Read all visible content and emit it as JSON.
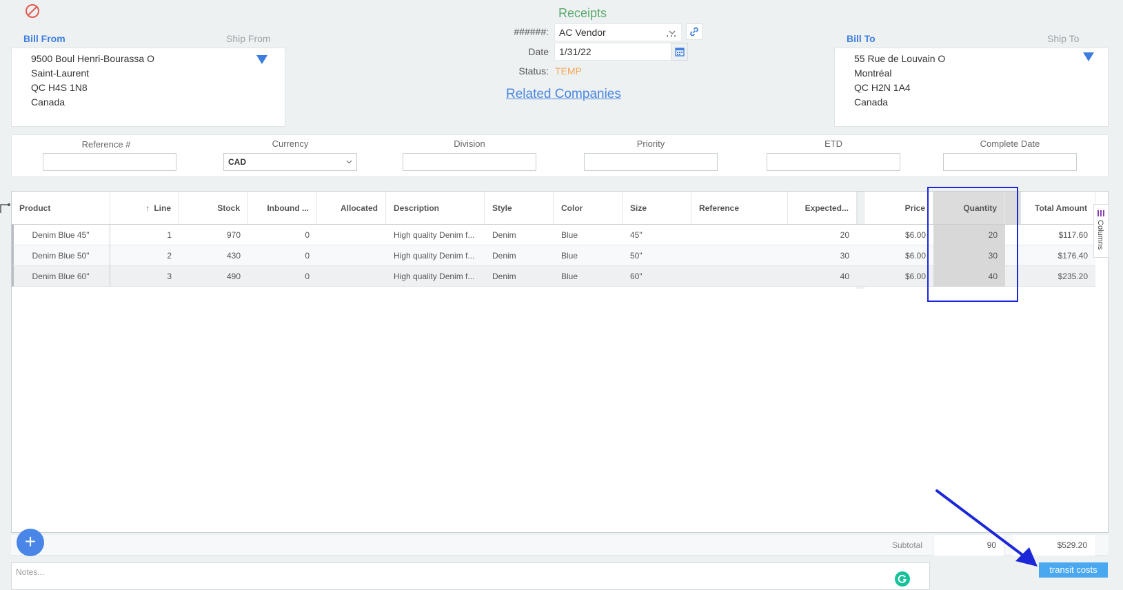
{
  "page": {
    "title": "Receipts",
    "vendor_label": "######:",
    "vendor_value": "AC Vendor",
    "date_label": "Date",
    "date_value": "1/31/22",
    "status_label": "Status:",
    "status_value": "TEMP",
    "related_companies": "Related Companies"
  },
  "bill_from": {
    "tab_active": "Bill From",
    "tab_inactive": "Ship From",
    "lines": [
      "9500 Boul Henri-Bourassa O",
      "Saint-Laurent",
      "QC H4S 1N8",
      "Canada"
    ]
  },
  "bill_to": {
    "tab_active": "Bill To",
    "tab_inactive": "Ship To",
    "lines": [
      "55 Rue de Louvain O",
      "Montréal",
      "QC H2N 1A4",
      "Canada"
    ]
  },
  "filters": {
    "reference_label": "Reference #",
    "reference_value": "",
    "currency_label": "Currency",
    "currency_value": "CAD",
    "division_label": "Division",
    "division_value": "",
    "priority_label": "Priority",
    "priority_value": "",
    "etd_label": "ETD",
    "etd_value": "",
    "complete_label": "Complete Date",
    "complete_value": ""
  },
  "grid": {
    "headers": {
      "product": "Product",
      "line": "Line",
      "stock": "Stock",
      "inbound": "Inbound ...",
      "allocated": "Allocated",
      "description": "Description",
      "style": "Style",
      "color": "Color",
      "size": "Size",
      "reference": "Reference",
      "expected": "Expected...",
      "price": "Price",
      "quantity": "Quantity",
      "total": "Total Amount"
    },
    "rows": [
      {
        "product": "Denim Blue 45\"",
        "line": "1",
        "stock": "970",
        "inbound": "0",
        "allocated": "",
        "description": "High quality Denim f...",
        "style": "Denim",
        "color": "Blue",
        "size": "45\"",
        "reference": "",
        "expected": "20",
        "price": "$6.00",
        "quantity": "20",
        "total": "$117.60"
      },
      {
        "product": "Denim Blue 50\"",
        "line": "2",
        "stock": "430",
        "inbound": "0",
        "allocated": "",
        "description": "High quality Denim f...",
        "style": "Denim",
        "color": "Blue",
        "size": "50\"",
        "reference": "",
        "expected": "30",
        "price": "$6.00",
        "quantity": "30",
        "total": "$176.40"
      },
      {
        "product": "Denim Blue 60\"",
        "line": "3",
        "stock": "490",
        "inbound": "0",
        "allocated": "",
        "description": "High quality Denim f...",
        "style": "Denim",
        "color": "Blue",
        "size": "60\"",
        "reference": "",
        "expected": "40",
        "price": "$6.00",
        "quantity": "40",
        "total": "$235.20"
      }
    ],
    "columns_tab": "Columns",
    "subtotal_label": "Subtotal",
    "subtotal_quantity": "90",
    "subtotal_total": "$529.20"
  },
  "footer": {
    "notes_placeholder": "Notes...",
    "transit_button": "transit costs"
  },
  "colors": {
    "accent_blue": "#3d7de0",
    "title_green": "#5aaa6e",
    "status_orange": "#f0a85a",
    "annotation_blue": "#1c28d8"
  }
}
